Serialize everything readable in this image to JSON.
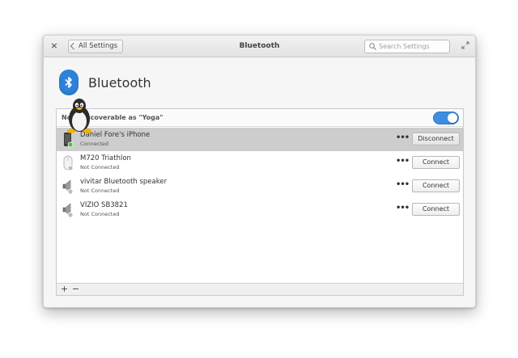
{
  "window": {
    "title": "Bluetooth",
    "back_label": "All Settings",
    "search_placeholder": "Search Settings",
    "close_glyph": "×"
  },
  "header": {
    "title": "Bluetooth",
    "icon": "bluetooth-icon",
    "icon_color": "#2d82d9"
  },
  "discoverable": {
    "label": "Now discoverable as \"Yoga\"",
    "enabled": true,
    "accent": "#3d8ee0"
  },
  "devices": [
    {
      "name": "Daniel Fore's iPhone",
      "status": "Connected",
      "action": "Disconnect",
      "icon": "phone-icon",
      "selected": true
    },
    {
      "name": "M720 Triathlon",
      "status": "Not Connected",
      "action": "Connect",
      "icon": "mouse-icon",
      "selected": false
    },
    {
      "name": "vivitar Bluetooth speaker",
      "status": "Not Connected",
      "action": "Connect",
      "icon": "speaker-icon",
      "selected": false
    },
    {
      "name": "VIZIO SB3821",
      "status": "Not Connected",
      "action": "Connect",
      "icon": "speaker-icon",
      "selected": false
    }
  ],
  "more_glyph": "•••",
  "toolbar": {
    "add": "+",
    "remove": "−"
  }
}
